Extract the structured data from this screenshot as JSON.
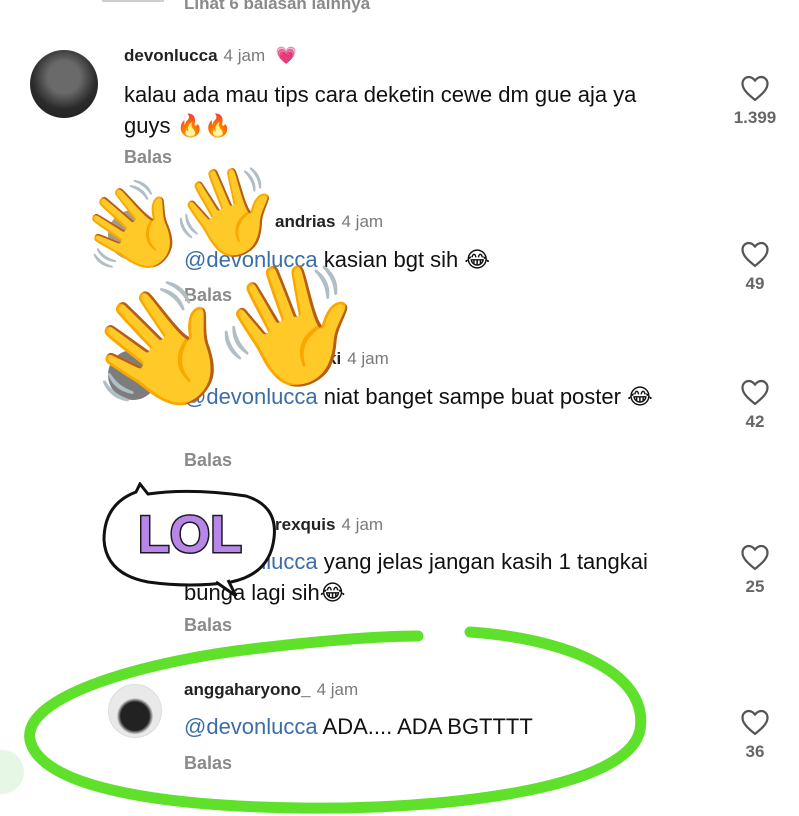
{
  "more_replies": "Lihat 6 balasan lainnya",
  "reply_label": "Balas",
  "comments": [
    {
      "username": "devonlucca",
      "time": "4 jam",
      "text": "kalau ada mau tips cara deketin cewe dm gue aja ya guys 🔥🔥",
      "likes": "1.399"
    },
    {
      "username": "andrias",
      "time": "4 jam",
      "mention": "@devonlucca",
      "text": "kasian bgt sih 😂",
      "likes": "49"
    },
    {
      "username": "ki",
      "time": "4 jam",
      "mention": "@devonlucca",
      "text": "niat banget sampe buat poster 😂",
      "likes": "42"
    },
    {
      "username": "rexquis",
      "time": "4 jam",
      "mention": "@devonlucca",
      "text": "yang jelas jangan kasih 1 tangkai bunga lagi sih😂",
      "likes": "25"
    },
    {
      "username": "anggaharyono_",
      "time": "4 jam",
      "mention": "@devonlucca",
      "text": "ADA.... ADA BGTTTT",
      "likes": "36"
    }
  ],
  "stickers": {
    "lol_text": "LOL",
    "hand_emoji": "👋"
  },
  "colors": {
    "circle": "#5fe02b",
    "lol_text": "#b886e8",
    "mention": "#3b6da8"
  }
}
